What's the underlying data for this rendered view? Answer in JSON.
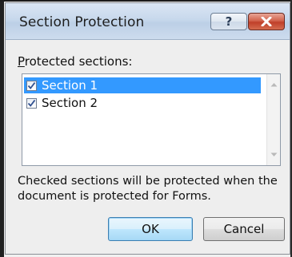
{
  "dialog": {
    "title": "Section Protection",
    "help_glyph": "?",
    "close_glyph": "×"
  },
  "protected_sections_label": "Protected sections:",
  "sections": [
    {
      "label": "Section 1",
      "checked": true,
      "selected": true
    },
    {
      "label": "Section 2",
      "checked": true,
      "selected": false
    }
  ],
  "description": "Checked sections will be protected when the document is protected for Forms.",
  "buttons": {
    "ok": "OK",
    "cancel": "Cancel"
  },
  "colors": {
    "selection": "#3399ff",
    "close_button": "#c0402a",
    "titlebar": "#c7d8ec"
  },
  "icons": {
    "help": "help-icon",
    "close": "close-icon",
    "check": "checkmark-icon",
    "scroll_up": "scroll-up-arrow-icon",
    "scroll_down": "scroll-down-arrow-icon"
  }
}
